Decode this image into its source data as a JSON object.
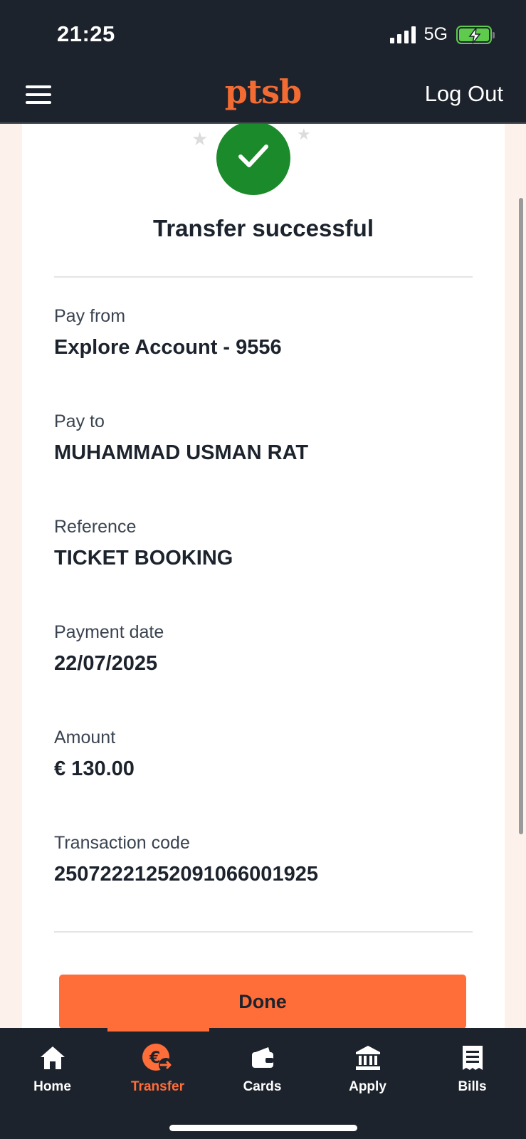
{
  "status_bar": {
    "time": "21:25",
    "network": "5G"
  },
  "header": {
    "logo": "ptsb",
    "logout_label": "Log Out"
  },
  "confirmation": {
    "title": "Transfer successful",
    "fields": [
      {
        "label": "Pay from",
        "value": "Explore Account - 9556"
      },
      {
        "label": "Pay to",
        "value": "MUHAMMAD USMAN RAT"
      },
      {
        "label": "Reference",
        "value": "TICKET BOOKING"
      },
      {
        "label": "Payment date",
        "value": "22/07/2025"
      },
      {
        "label": "Amount",
        "value": "€ 130.00"
      },
      {
        "label": "Transaction code",
        "value": "25072221252091066001925"
      }
    ],
    "done_label": "Done"
  },
  "tabbar": {
    "tabs": [
      {
        "label": "Home",
        "icon": "home-icon"
      },
      {
        "label": "Transfer",
        "icon": "euro-transfer-icon",
        "active": true
      },
      {
        "label": "Cards",
        "icon": "wallet-icon"
      },
      {
        "label": "Apply",
        "icon": "bank-icon"
      },
      {
        "label": "Bills",
        "icon": "receipt-icon"
      }
    ]
  },
  "colors": {
    "brand": "#f26b32",
    "accent": "#ff6d39",
    "success": "#1b8a2a",
    "header_bg": "#1d232d"
  }
}
